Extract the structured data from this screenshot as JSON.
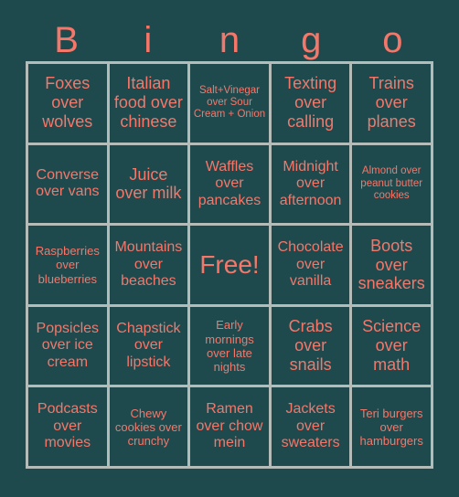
{
  "card": {
    "title_letters": [
      "B",
      "i",
      "n",
      "g",
      "o"
    ],
    "colors": {
      "background": "#1e4a4e",
      "text": "#f4776a",
      "grid_line": "#b4bcba"
    },
    "columns": 5,
    "rows": 5,
    "cells": [
      {
        "text": "Foxes over wolves",
        "size": "fs-lg"
      },
      {
        "text": "Italian food over chinese",
        "size": "fs-lg"
      },
      {
        "text": "Salt+Vinegar over Sour Cream + Onion",
        "size": "fs-xs"
      },
      {
        "text": "Texting over calling",
        "size": "fs-lg"
      },
      {
        "text": "Trains over planes",
        "size": "fs-lg"
      },
      {
        "text": "Converse over vans",
        "size": "fs-md"
      },
      {
        "text": "Juice over milk",
        "size": "fs-lg"
      },
      {
        "text": "Waffles over pancakes",
        "size": "fs-md"
      },
      {
        "text": "Midnight over afternoon",
        "size": "fs-md"
      },
      {
        "text": "Almond over peanut butter cookies",
        "size": "fs-xs"
      },
      {
        "text": "Raspberries over blueberries",
        "size": "fs-sm"
      },
      {
        "text": "Mountains over beaches",
        "size": "fs-md"
      },
      {
        "text": "Free!",
        "size": "fs-xl"
      },
      {
        "text": "Chocolate over vanilla",
        "size": "fs-md"
      },
      {
        "text": "Boots over sneakers",
        "size": "fs-lg"
      },
      {
        "text": "Popsicles over ice cream",
        "size": "fs-md"
      },
      {
        "text": "Chapstick over lipstick",
        "size": "fs-md"
      },
      {
        "text": "Early mornings over late nights",
        "size": "fs-sm"
      },
      {
        "text": "Crabs over snails",
        "size": "fs-lg"
      },
      {
        "text": "Science over math",
        "size": "fs-lg"
      },
      {
        "text": "Podcasts over movies",
        "size": "fs-md"
      },
      {
        "text": "Chewy cookies over crunchy",
        "size": "fs-sm"
      },
      {
        "text": "Ramen over chow mein",
        "size": "fs-md"
      },
      {
        "text": "Jackets over sweaters",
        "size": "fs-md"
      },
      {
        "text": "Teri burgers over hamburgers",
        "size": "fs-sm"
      }
    ]
  }
}
